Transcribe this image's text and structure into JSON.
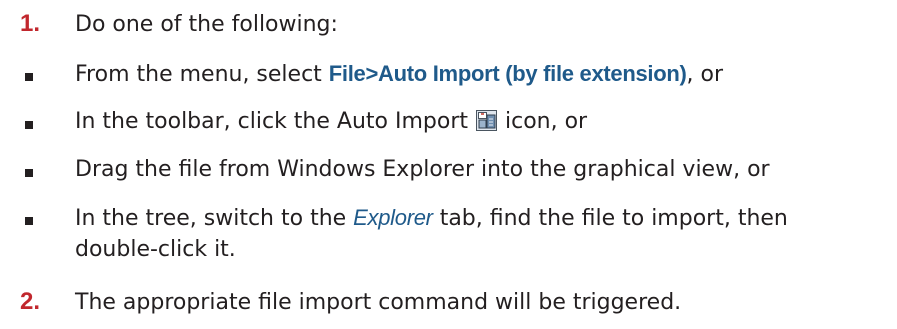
{
  "steps": [
    {
      "number": "1.",
      "text": "Do one of the following:"
    },
    {
      "number": "2.",
      "text": "The appropriate file import command will be triggered."
    }
  ],
  "bullets": {
    "menu": {
      "prefix": "From the menu, select ",
      "menu_path": "File>Auto Import (by file extension)",
      "suffix": ", or"
    },
    "toolbar": {
      "prefix": "In the toolbar, click the Auto Import ",
      "icon": "auto-import-icon",
      "suffix": " icon, or"
    },
    "drag": {
      "text": "Drag the file from Windows Explorer into the graphical view, or"
    },
    "tree": {
      "prefix": "In the tree, switch to the ",
      "tab_name": "Explorer",
      "suffix": " tab, find the file to import, then double-click it."
    }
  }
}
